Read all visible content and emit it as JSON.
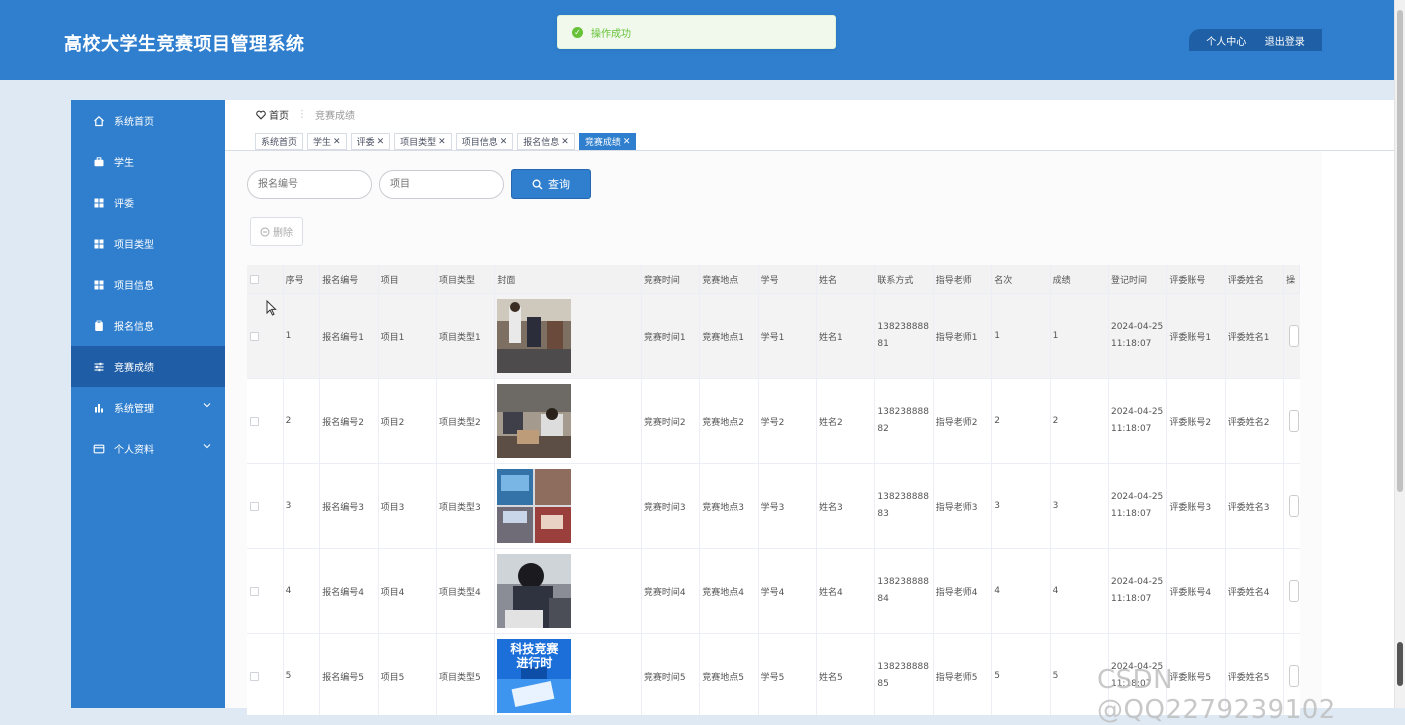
{
  "app": {
    "title": "高校大学生竞赛项目管理系统"
  },
  "toast": {
    "message": "操作成功"
  },
  "header": {
    "profile": "个人中心",
    "logout": "退出登录"
  },
  "sidebar": {
    "items": [
      {
        "label": "系统首页",
        "icon": "home-icon"
      },
      {
        "label": "学生",
        "icon": "briefcase-icon"
      },
      {
        "label": "评委",
        "icon": "grid-icon"
      },
      {
        "label": "项目类型",
        "icon": "grid-icon"
      },
      {
        "label": "项目信息",
        "icon": "grid-icon"
      },
      {
        "label": "报名信息",
        "icon": "clipboard-icon"
      },
      {
        "label": "竞赛成绩",
        "icon": "sliders-icon",
        "active": true
      },
      {
        "label": "系统管理",
        "icon": "bar-chart-icon",
        "expandable": true
      },
      {
        "label": "个人资料",
        "icon": "card-icon",
        "expandable": true
      }
    ]
  },
  "breadcrumb": {
    "home": "首页",
    "current": "竞赛成绩"
  },
  "tabs": [
    {
      "label": "系统首页",
      "closable": false
    },
    {
      "label": "学生",
      "closable": true
    },
    {
      "label": "评委",
      "closable": true
    },
    {
      "label": "项目类型",
      "closable": true
    },
    {
      "label": "项目信息",
      "closable": true
    },
    {
      "label": "报名信息",
      "closable": true
    },
    {
      "label": "竞赛成绩",
      "closable": true,
      "active": true
    }
  ],
  "search": {
    "reg_placeholder": "报名编号",
    "project_placeholder": "项目",
    "query_label": "查询"
  },
  "actions": {
    "delete_label": "删除"
  },
  "table": {
    "headers": [
      "序号",
      "报名编号",
      "项目",
      "项目类型",
      "封面",
      "竞赛时间",
      "竞赛地点",
      "学号",
      "姓名",
      "联系方式",
      "指导老师",
      "名次",
      "成绩",
      "登记时间",
      "评委账号",
      "评委姓名",
      "操"
    ],
    "rows": [
      {
        "idx": "1",
        "reg": "报名编号1",
        "project": "项目1",
        "ptype": "项目类型1",
        "time": "竞赛时间1",
        "place": "竞赛地点1",
        "sid": "学号1",
        "name": "姓名1",
        "phone": "13823888881",
        "teacher": "指导老师1",
        "rank": "1",
        "score": "1",
        "regtime": "2024-04-25 11:18:07",
        "jacc": "评委账号1",
        "jname": "评委姓名1"
      },
      {
        "idx": "2",
        "reg": "报名编号2",
        "project": "项目2",
        "ptype": "项目类型2",
        "time": "竞赛时间2",
        "place": "竞赛地点2",
        "sid": "学号2",
        "name": "姓名2",
        "phone": "13823888882",
        "teacher": "指导老师2",
        "rank": "2",
        "score": "2",
        "regtime": "2024-04-25 11:18:07",
        "jacc": "评委账号2",
        "jname": "评委姓名2"
      },
      {
        "idx": "3",
        "reg": "报名编号3",
        "project": "项目3",
        "ptype": "项目类型3",
        "time": "竞赛时间3",
        "place": "竞赛地点3",
        "sid": "学号3",
        "name": "姓名3",
        "phone": "13823888883",
        "teacher": "指导老师3",
        "rank": "3",
        "score": "3",
        "regtime": "2024-04-25 11:18:07",
        "jacc": "评委账号3",
        "jname": "评委姓名3"
      },
      {
        "idx": "4",
        "reg": "报名编号4",
        "project": "项目4",
        "ptype": "项目类型4",
        "time": "竞赛时间4",
        "place": "竞赛地点4",
        "sid": "学号4",
        "name": "姓名4",
        "phone": "13823888884",
        "teacher": "指导老师4",
        "rank": "4",
        "score": "4",
        "regtime": "2024-04-25 11:18:07",
        "jacc": "评委账号4",
        "jname": "评委姓名4"
      },
      {
        "idx": "5",
        "reg": "报名编号5",
        "project": "项目5",
        "ptype": "项目类型5",
        "time": "竞赛时间5",
        "place": "竞赛地点5",
        "sid": "学号5",
        "name": "姓名5",
        "phone": "13823888885",
        "teacher": "指导老师5",
        "rank": "5",
        "score": "5",
        "regtime": "2024-04-25 11:18:07",
        "jacc": "评委账号5",
        "jname": "评委姓名5"
      }
    ],
    "cover5_text": [
      "科技竞赛",
      "进行时"
    ]
  },
  "watermark": "CSDN @QQ2279239102",
  "colors": {
    "primary": "#2f7fce",
    "sidebar_active": "#1f5ea6",
    "success": "#67c23a"
  }
}
